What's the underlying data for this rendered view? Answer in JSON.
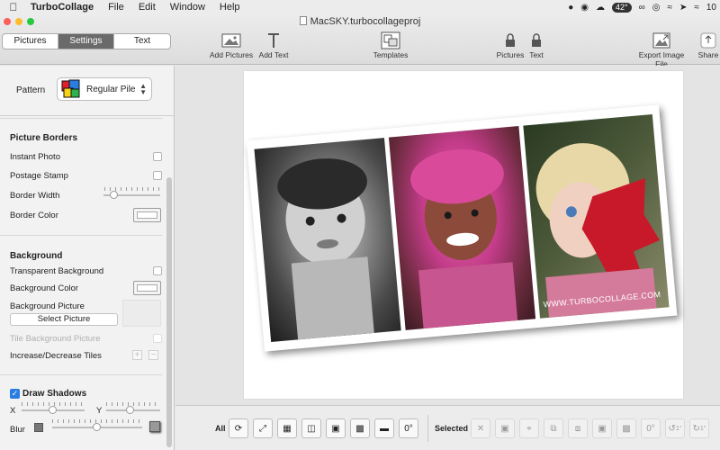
{
  "menubar": {
    "app_name": "TurboCollage",
    "items": [
      "File",
      "Edit",
      "Window",
      "Help"
    ],
    "temperature": "42°",
    "clock": "10"
  },
  "window": {
    "title": "MacSKY.turbocollageproj"
  },
  "tabs": [
    {
      "label": "Pictures",
      "active": false
    },
    {
      "label": "Settings",
      "active": true
    },
    {
      "label": "Text",
      "active": false
    }
  ],
  "toolbar": {
    "add_pictures": "Add Pictures",
    "add_text": "Add Text",
    "templates": "Templates",
    "lock_pictures": "Pictures",
    "lock_text": "Text",
    "export": "Export Image File",
    "share": "Share"
  },
  "sidebar": {
    "pattern_label": "Pattern",
    "pattern_value": "Regular Pile",
    "picture_borders": {
      "heading": "Picture Borders",
      "instant_photo": "Instant Photo",
      "postage_stamp": "Postage Stamp",
      "border_width": "Border Width",
      "border_color": "Border Color"
    },
    "background": {
      "heading": "Background",
      "transparent": "Transparent Background",
      "color": "Background Color",
      "picture": "Background Picture",
      "select_picture": "Select Picture",
      "tile": "Tile Background Picture",
      "tiles": "Increase/Decrease Tiles"
    },
    "shadows": {
      "heading": "Draw Shadows",
      "checked": true,
      "x": "X",
      "y": "Y",
      "blur": "Blur"
    }
  },
  "collage": {
    "watermark": "WWW.TURBOCOLLAGE.COM"
  },
  "bottombar": {
    "all_label": "All",
    "selected_label": "Selected",
    "rotate_deg": "0°",
    "sel_rotate_deg": "0°",
    "sel_rot_ccw": "1°",
    "sel_rot_cw": "1°"
  },
  "colors": {
    "active_tab": "#6a6a6a",
    "checkbox_accent": "#2a7de1",
    "close": "#fc5f57",
    "minimize": "#fdbc2e",
    "zoom": "#28c840"
  },
  "icons": [
    "apple-icon",
    "image-icon",
    "text-icon",
    "templates-icon",
    "lock-icon",
    "export-icon",
    "share-icon"
  ]
}
